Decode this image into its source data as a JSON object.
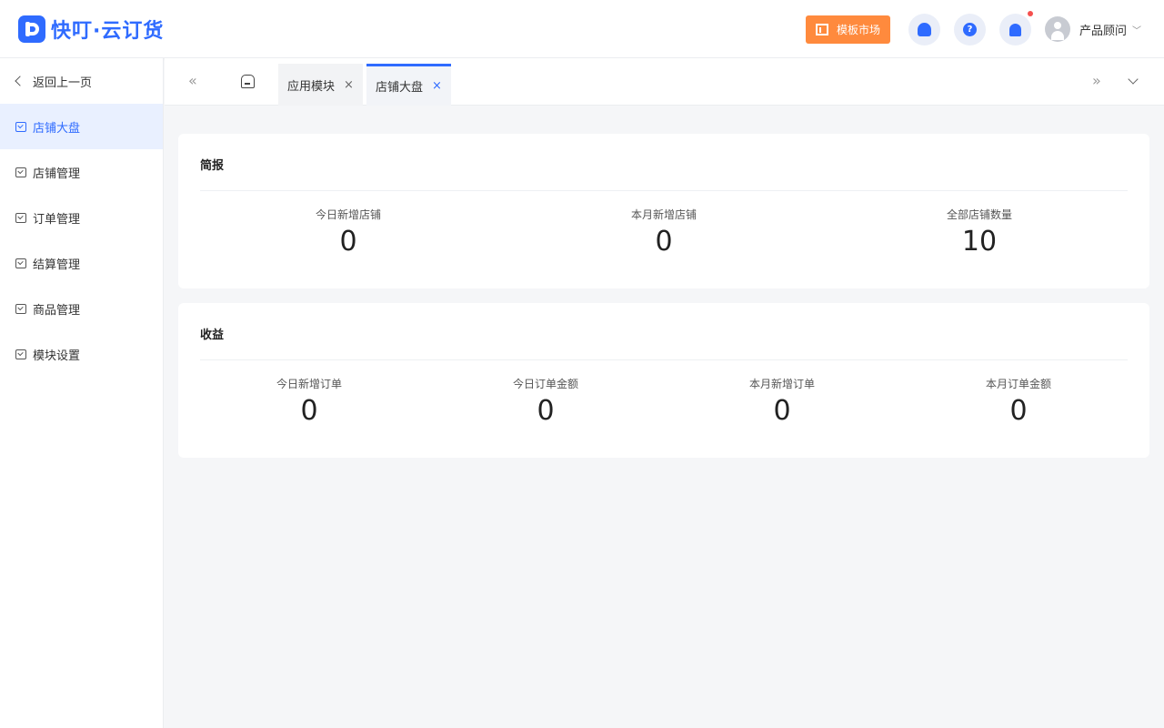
{
  "header": {
    "logo_text": "快叮·云订货",
    "template_button": "模板市场",
    "help_icon_glyph": "?",
    "user_name": "产品顾问",
    "user_chevron": "﹀"
  },
  "sidebar": {
    "back_label": "返回上一页",
    "items": [
      {
        "label": "店铺大盘",
        "active": true
      },
      {
        "label": "店铺管理",
        "active": false
      },
      {
        "label": "订单管理",
        "active": false
      },
      {
        "label": "结算管理",
        "active": false
      },
      {
        "label": "商品管理",
        "active": false
      },
      {
        "label": "模块设置",
        "active": false
      }
    ]
  },
  "tabs": {
    "prev_glyph": "«",
    "next_glyph": "»",
    "close_glyph": "×",
    "items": [
      {
        "label": "应用模块",
        "active": false
      },
      {
        "label": "店铺大盘",
        "active": true
      }
    ]
  },
  "brief": {
    "title": "简报",
    "stats": [
      {
        "label": "今日新增店铺",
        "value": "0"
      },
      {
        "label": "本月新增店铺",
        "value": "0"
      },
      {
        "label": "全部店铺数量",
        "value": "10"
      }
    ]
  },
  "revenue": {
    "title": "收益",
    "stats": [
      {
        "label": "今日新增订单",
        "value": "0"
      },
      {
        "label": "今日订单金额",
        "value": "0"
      },
      {
        "label": "本月新增订单",
        "value": "0"
      },
      {
        "label": "本月订单金额",
        "value": "0"
      }
    ]
  },
  "colors": {
    "primary": "#2f6bff",
    "template_button": "#ff8a3d",
    "notification_dot": "#f5504e"
  }
}
